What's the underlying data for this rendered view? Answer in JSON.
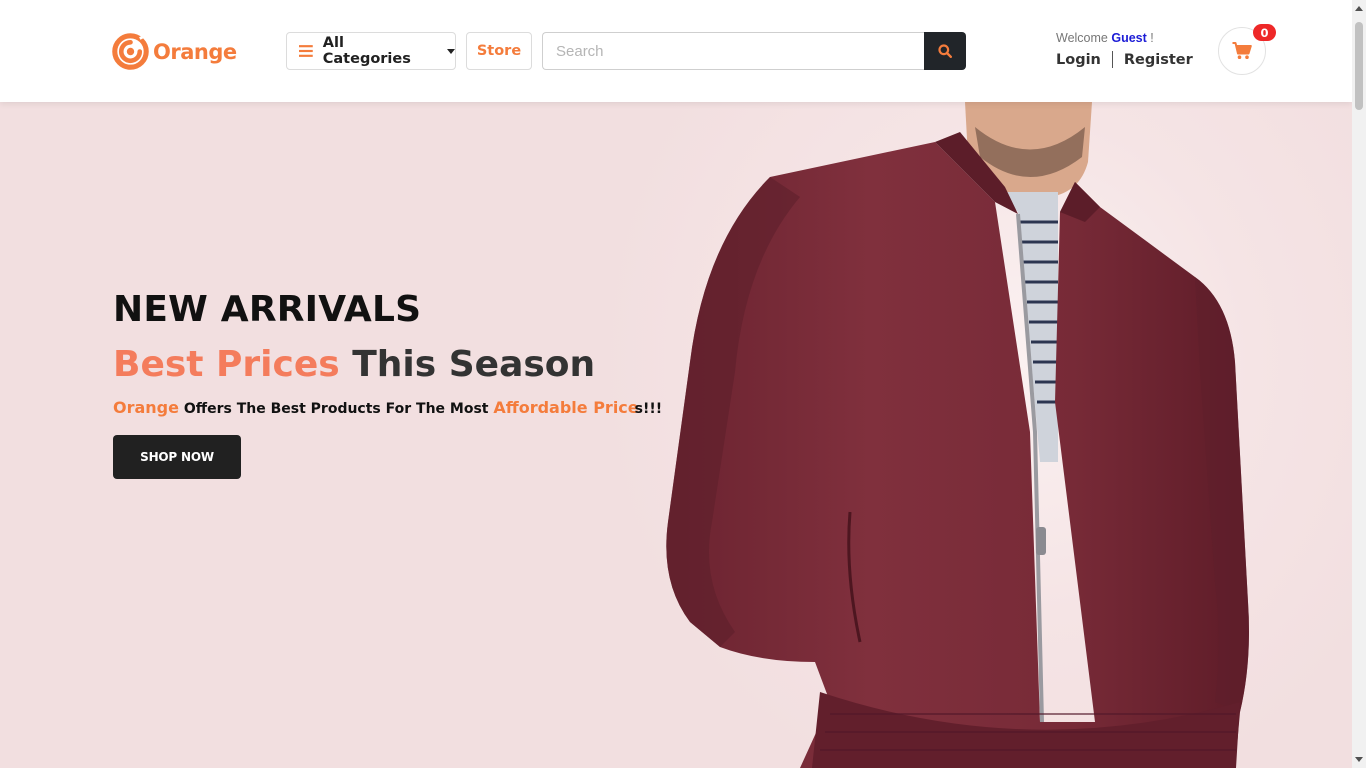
{
  "header": {
    "brand": "Orange",
    "categories_label": "All Categories",
    "store_label": "Store",
    "search": {
      "placeholder": "Search",
      "value": ""
    },
    "account": {
      "welcome": "Welcome",
      "user": "Guest",
      "suffix": "!",
      "login": "Login",
      "register": "Register"
    },
    "cart_count": "0"
  },
  "hero": {
    "headline": "NEW ARRIVALS",
    "tagline_accent": "Best Prices",
    "tagline_rest": "This Season",
    "subtitle": {
      "brand": "Orange",
      "middle": "Offers The Best Products For The Most",
      "accent": "Affordable Price",
      "end": "s!!!"
    },
    "cta": "SHOP NOW"
  },
  "colors": {
    "brand": "#f47c3c",
    "badge": "#ee2828",
    "dark": "#212121",
    "hero_bg": "#f3dfe1",
    "jacket": "#7a2a36"
  },
  "icons": [
    "orange-logo-icon",
    "hamburger-icon",
    "caret-down-icon",
    "search-icon",
    "cart-icon"
  ]
}
